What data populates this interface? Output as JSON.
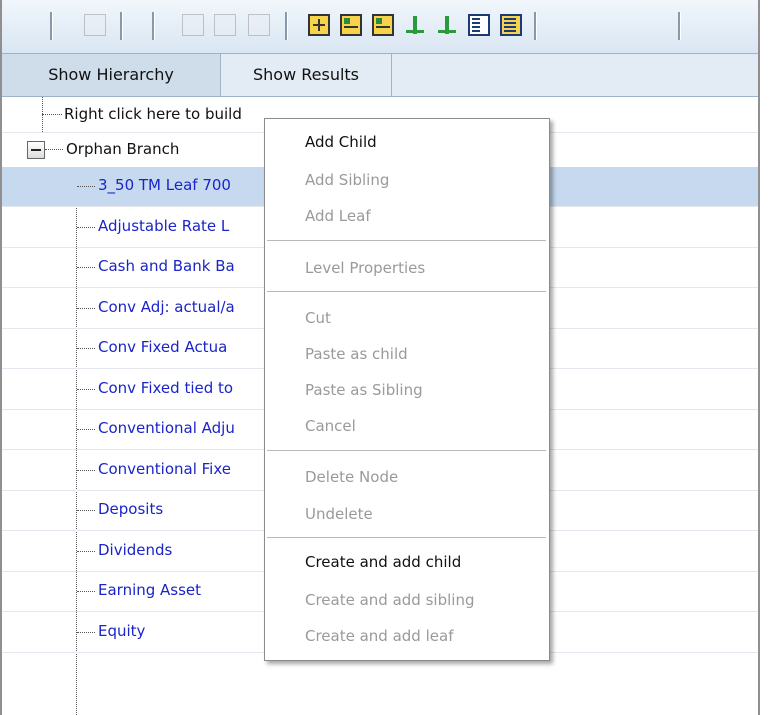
{
  "tabs": [
    {
      "label": "Show Hierarchy",
      "active": true
    },
    {
      "label": "Show Results",
      "active": false
    }
  ],
  "toolbar": {
    "icons": [
      "find-icon",
      "move-up-icon",
      "move-left-icon",
      "move-right-icon",
      "add-child-icon",
      "add-sibling-icon",
      "add-leaf-icon",
      "hierarchy-icon",
      "hierarchy-add-icon",
      "list-icon",
      "properties-icon"
    ]
  },
  "tree": {
    "hint": "Right click here to buil",
    "hint_suffix": "d",
    "root": "Orphan Branch",
    "leaves": [
      "3_50 TM Leaf 700",
      "Adjustable Rate L",
      "Cash and Bank Ba",
      "Conv Adj: actual/a",
      "Conv Fixed Actua",
      "Conv Fixed tied to",
      "Conventional Adju",
      "Conventional Fixe",
      "Deposits",
      "Dividends",
      "Earning Asset",
      "Equity"
    ],
    "selected_index": 0
  },
  "context_menu": {
    "items": [
      {
        "label": "Add Child",
        "enabled": true
      },
      {
        "label": "Add Sibling",
        "enabled": false
      },
      {
        "label": "Add Leaf",
        "enabled": false
      },
      {
        "label": "Level Properties",
        "enabled": false
      },
      {
        "label": "Cut",
        "enabled": false
      },
      {
        "label": "Paste as child",
        "enabled": false
      },
      {
        "label": "Paste as Sibling",
        "enabled": false
      },
      {
        "label": "Cancel",
        "enabled": false
      },
      {
        "label": "Delete Node",
        "enabled": false
      },
      {
        "label": "Undelete",
        "enabled": false
      },
      {
        "label": "Create and add child",
        "enabled": true
      },
      {
        "label": "Create and add sibling",
        "enabled": false
      },
      {
        "label": "Create and add leaf",
        "enabled": false
      }
    ]
  }
}
